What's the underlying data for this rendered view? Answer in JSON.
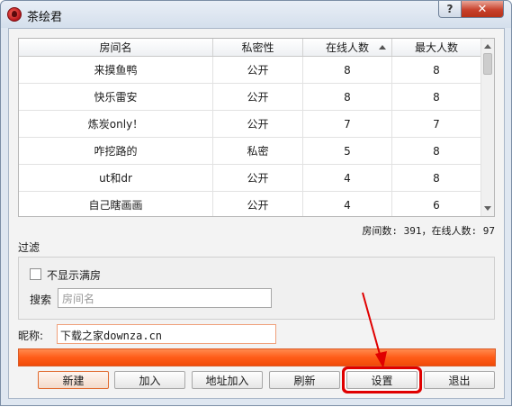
{
  "window": {
    "title": "茶绘君",
    "help_glyph": "?",
    "close_glyph": "✕"
  },
  "table": {
    "columns": [
      "房间名",
      "私密性",
      "在线人数",
      "最大人数"
    ],
    "sorted_column": "在线人数",
    "sort_direction": "ascending",
    "rows": [
      [
        "来摸鱼鸭",
        "公开",
        "8",
        "8"
      ],
      [
        "快乐雷安",
        "公开",
        "8",
        "8"
      ],
      [
        "炼炭only！",
        "公开",
        "7",
        "7"
      ],
      [
        "咋挖路的",
        "私密",
        "5",
        "8"
      ],
      [
        "ut和dr",
        "公开",
        "4",
        "8"
      ],
      [
        "自己瞎画画",
        "公开",
        "4",
        "6"
      ]
    ]
  },
  "stats": "房间数: 391，在线人数: 97",
  "filter": {
    "label": "过滤",
    "hide_full_label": "不显示满房",
    "hide_full_checked": false,
    "search_label": "搜索",
    "search_placeholder": "房间名",
    "search_value": ""
  },
  "nickname": {
    "label": "昵称:",
    "value": "下载之家downza.cn"
  },
  "progress": {
    "fraction": 1.0,
    "color": "#ff6320"
  },
  "buttons": {
    "new": "新建",
    "join": "加入",
    "address_join": "地址加入",
    "refresh": "刷新",
    "settings": "设置",
    "exit": "退出"
  },
  "colors": {
    "highlight": "#e00000",
    "accent": "#ff6320"
  }
}
